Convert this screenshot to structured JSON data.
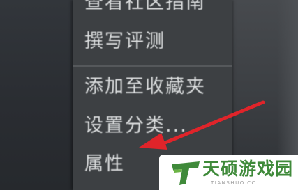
{
  "context_menu": {
    "items": [
      {
        "label": "查看社区指南"
      },
      {
        "label": "撰写评测"
      },
      {
        "label": "添加至收藏夹"
      },
      {
        "label": "设置分类..."
      },
      {
        "label": "属性"
      }
    ]
  },
  "annotation": {
    "arrow_color": "#e0242a"
  },
  "watermark": {
    "logo_icon": "tianshuo-logo",
    "name": "天硕游戏园",
    "domain": "TIANSHUO.CC",
    "brand_color": "#3f8a3a"
  }
}
